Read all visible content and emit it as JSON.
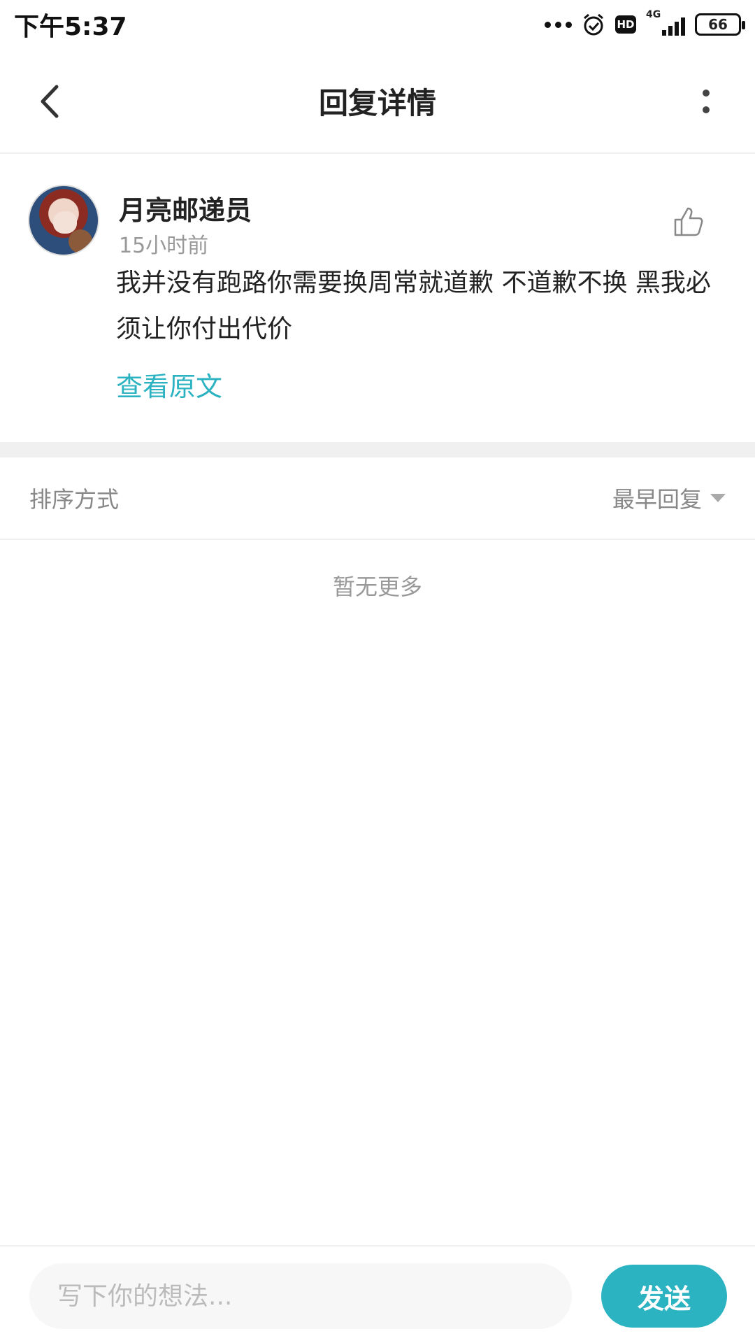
{
  "status_bar": {
    "time": "下午5:37",
    "network": "4G",
    "hd": "HD",
    "battery": "66"
  },
  "header": {
    "title": "回复详情"
  },
  "comment": {
    "username": "月亮邮递员",
    "timestamp": "15小时前",
    "text": "我并没有跑路你需要换周常就道歉 不道歉不换 黑我必须让你付出代价",
    "view_original": "查看原文"
  },
  "sort": {
    "label": "排序方式",
    "selected": "最早回复"
  },
  "list": {
    "empty_text": "暂无更多"
  },
  "input_bar": {
    "placeholder": "写下你的想法...",
    "send_label": "发送"
  },
  "colors": {
    "accent": "#2bb3c2"
  }
}
